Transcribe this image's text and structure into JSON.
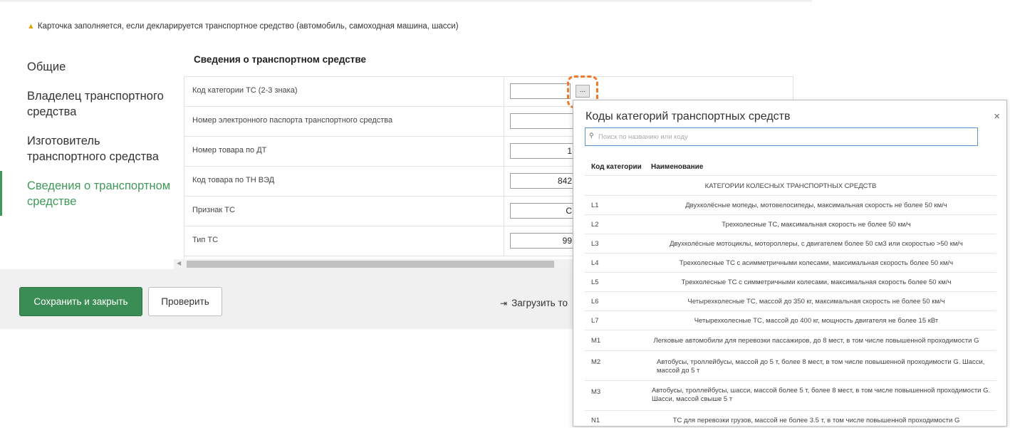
{
  "notice": "Карточка заполняется, если декларируется транспортное средство (автомобиль, самоходная машина, шасси)",
  "nav": [
    {
      "label": "Общие"
    },
    {
      "label": "Владелец транспортного средства"
    },
    {
      "label": "Изготовитель транспортного средства"
    },
    {
      "label": "Сведения о транспортном средстве"
    }
  ],
  "section_title": "Сведения о транспортном средстве",
  "fields": [
    {
      "label": "Код категории ТС (2-3 знака)",
      "value": ""
    },
    {
      "label": "Номер электронного паспорта транспортного средства",
      "value": ""
    },
    {
      "label": "Номер товара по ДТ",
      "value": "1"
    },
    {
      "label": "Код товара по ТН ВЭД",
      "value": "842"
    },
    {
      "label": "Признак ТС",
      "value": "С"
    },
    {
      "label": "Тип ТС",
      "value": "99"
    }
  ],
  "dots_label": "...",
  "footer": {
    "save_label": "Сохранить и закрыть",
    "check_label": "Проверить",
    "load_label": "Загрузить то"
  },
  "popup": {
    "title": "Коды категорий транспортных средств",
    "close": "×",
    "search_placeholder": "Поиск по названию или коду",
    "col_code": "Код категории",
    "col_name": "Наименование",
    "group_label": "КАТЕГОРИИ КОЛЕСНЫХ ТРАНСПОРТНЫХ СРЕДСТВ",
    "rows": [
      {
        "code": "L1",
        "name": "Двухколёсные мопеды, мотовелосипеды, максимальная скорость не более 50 км/ч"
      },
      {
        "code": "L2",
        "name": "Трехколесные ТС, максимальная скорость не более 50 км/ч"
      },
      {
        "code": "L3",
        "name": "Двухколёсные мотоциклы, мотороллеры, с двигателем более 50 см3 или скоростью >50 км/ч"
      },
      {
        "code": "L4",
        "name": "Трехколесные ТС с асимметричными колесами, максимальная скорость более 50 км/ч"
      },
      {
        "code": "L5",
        "name": "Трехколесные ТС с симметричными колесами, максимальная скорость более 50 км/ч"
      },
      {
        "code": "L6",
        "name": "Четырехколесные ТС, массой до 350 кг, максимальная скорость не более 50 км/ч"
      },
      {
        "code": "L7",
        "name": "Четырехколесные ТС, массой до 400 кг, мощность двигателя не более 15 кВт"
      },
      {
        "code": "M1",
        "name": "Легковые автомобили для перевозки пассажиров, до 8 мест, в том числе повышенной проходимости G"
      },
      {
        "code": "M2",
        "name": "Автобусы, троллейбусы, массой до 5 т, более 8 мест, в том числе повышенной проходимости G. Шасси, массой до 5 т"
      },
      {
        "code": "M3",
        "name": "Автобусы, троллейбусы, шасси, массой более 5 т, более 8 мест, в том числе повышенной проходимости G. Шасси, массой свыше 5 т"
      },
      {
        "code": "N1",
        "name": "ТС для перевозки грузов, массой не более 3.5 т, в том числе повышенной проходимости G"
      }
    ]
  }
}
